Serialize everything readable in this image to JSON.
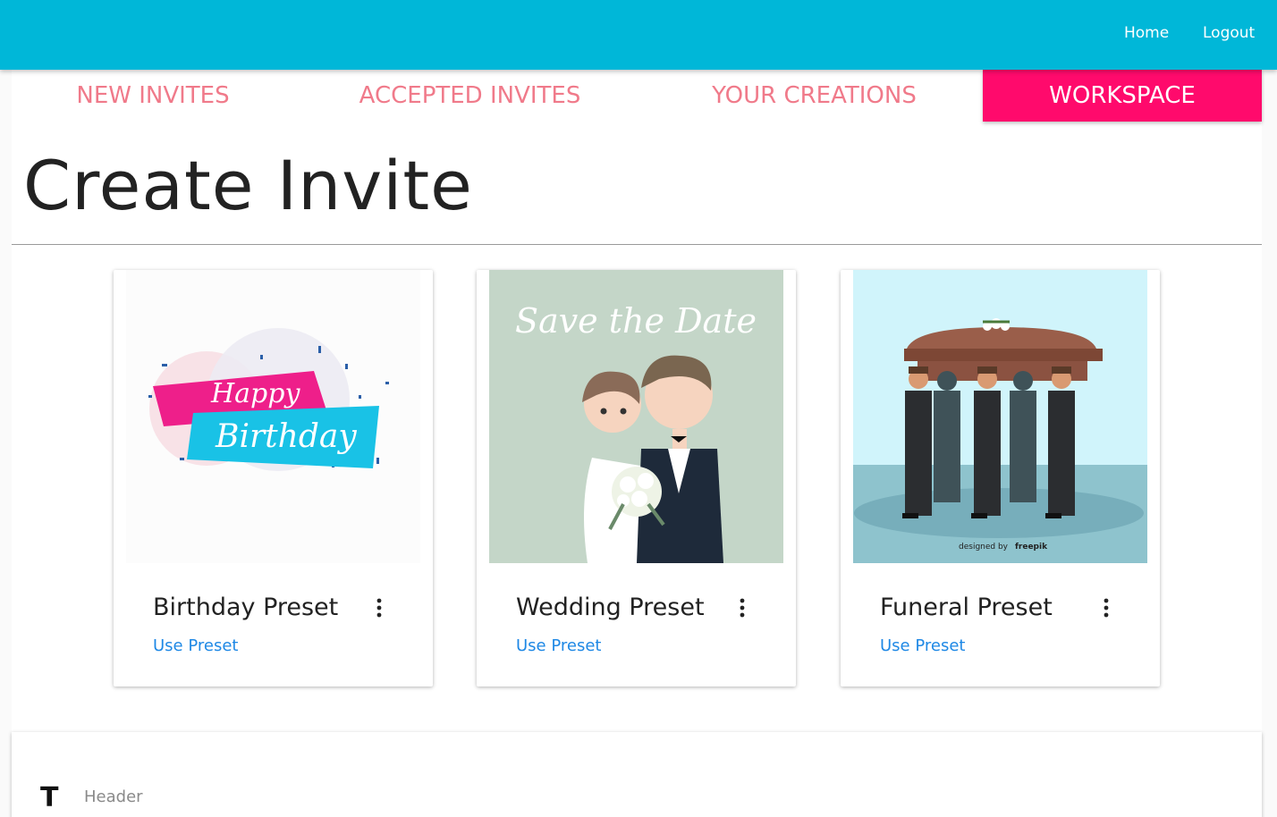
{
  "nav": {
    "home": "Home",
    "logout": "Logout"
  },
  "tabs": [
    {
      "label": "NEW INVITES",
      "active": false
    },
    {
      "label": "ACCEPTED INVITES",
      "active": false
    },
    {
      "label": "YOUR CREATIONS",
      "active": false
    },
    {
      "label": "WORKSPACE",
      "active": true
    }
  ],
  "page": {
    "title": "Create Invite"
  },
  "cards": [
    {
      "title": "Birthday Preset",
      "action": "Use Preset",
      "image_text": [
        "Happy",
        "Birthday"
      ]
    },
    {
      "title": "Wedding Preset",
      "action": "Use Preset",
      "image_text": [
        "Save the Date"
      ]
    },
    {
      "title": "Funeral Preset",
      "action": "Use Preset",
      "image_text": [
        "designed by",
        "freepik"
      ]
    }
  ],
  "editor": {
    "tool_icon": "T",
    "label": "Header"
  },
  "colors": {
    "topbar": "#00b7d8",
    "active_tab": "#ff0a6c",
    "tab_text": "#f07a8a",
    "link": "#1e88e5"
  }
}
